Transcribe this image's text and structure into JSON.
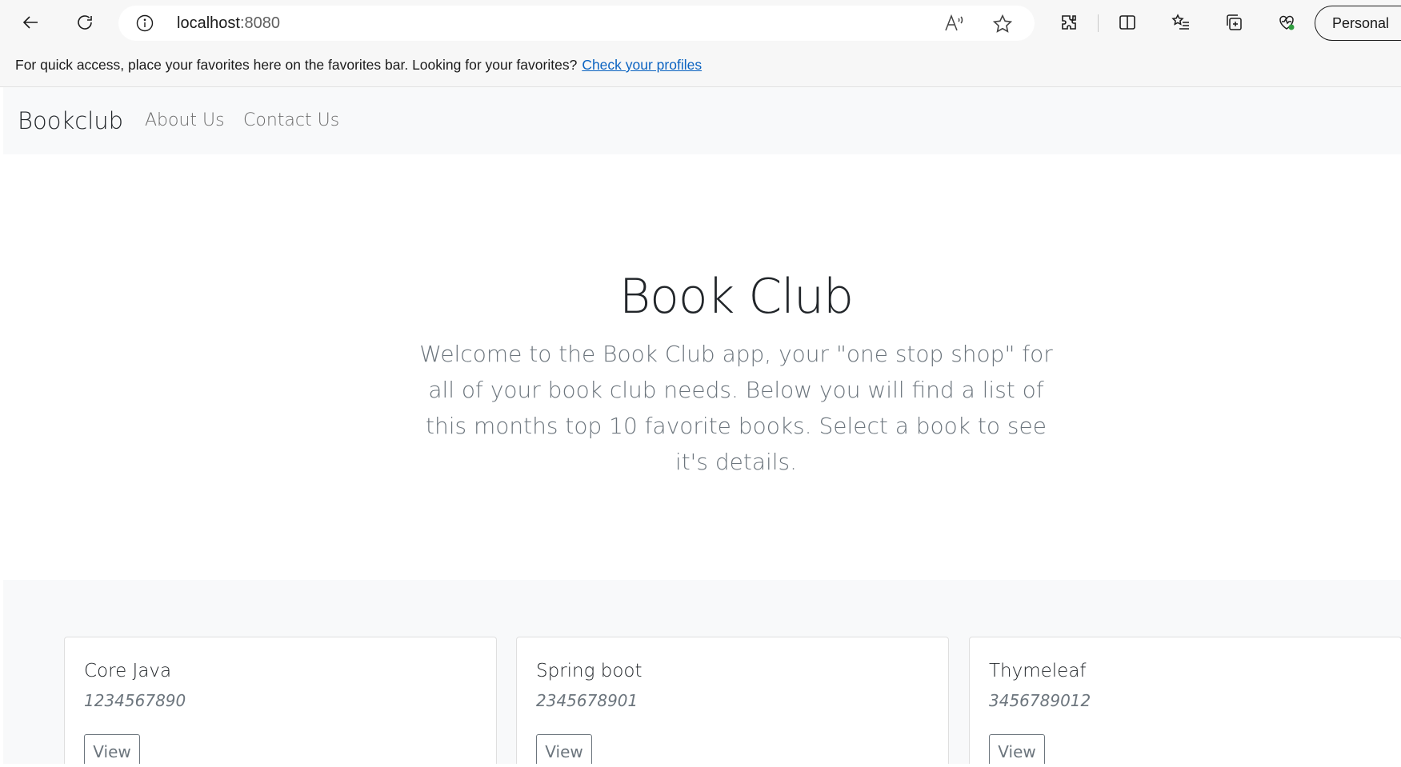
{
  "browser": {
    "url_host": "localhost",
    "url_port": ":8080",
    "profile_label": "Personal",
    "icons": [
      "back-arrow-icon",
      "refresh-icon",
      "info-icon",
      "read-aloud-icon",
      "favorite-star-icon",
      "extensions-icon",
      "split-screen-icon",
      "favorites-list-icon",
      "collections-icon",
      "browser-essentials-icon"
    ]
  },
  "favorites_bar": {
    "message": "For quick access, place your favorites here on the favorites bar. Looking for your favorites?",
    "link": "Check your profiles"
  },
  "navbar": {
    "brand": "Bookclub",
    "links": [
      "About Us",
      "Contact Us"
    ]
  },
  "hero": {
    "title": "Book Club",
    "lead": "Welcome to the Book Club app, your \"one stop shop\" for all of your book club needs. Below you will find a list of this months top 10 favorite books. Select a book to see it's details."
  },
  "books": [
    {
      "title": "Core Java",
      "isbn": "1234567890",
      "button": "View"
    },
    {
      "title": "Spring boot",
      "isbn": "2345678901",
      "button": "View"
    },
    {
      "title": "Thymeleaf",
      "isbn": "3456789012",
      "button": "View"
    }
  ],
  "colors": {
    "chrome_bg": "#f7f7f7",
    "link_blue": "#0b63c1",
    "navbar_bg": "#f8f9fa",
    "muted_text": "#6c757d"
  }
}
